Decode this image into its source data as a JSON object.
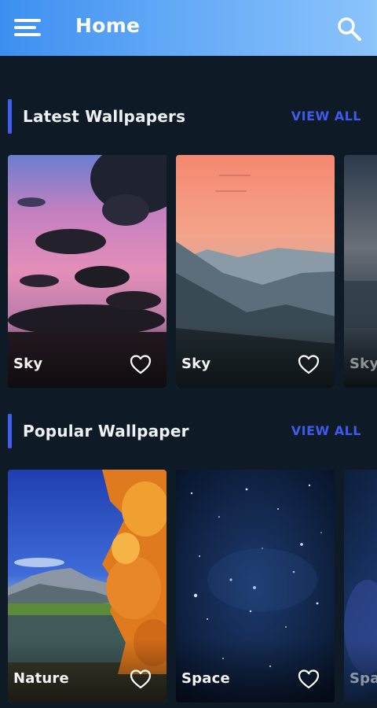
{
  "app_bar": {
    "title": "Home",
    "menu_icon": "hamburger-menu-icon",
    "search_icon": "search-icon",
    "gradient_start": "#3c8ff0",
    "gradient_end": "#8cc4fb"
  },
  "sections": [
    {
      "title": "Latest Wallpapers",
      "action": "VIEW ALL",
      "cards": [
        {
          "label": "Sky",
          "scene": "pink-cloud-sky"
        },
        {
          "label": "Sky",
          "scene": "peach-mountain-sky"
        },
        {
          "label": "Sky",
          "scene": "ocean-dusk"
        }
      ]
    },
    {
      "title": "Popular Wallpaper",
      "action": "VIEW ALL",
      "cards": [
        {
          "label": "Nature",
          "scene": "autumn-lake"
        },
        {
          "label": "Space",
          "scene": "starfield"
        },
        {
          "label": "Space",
          "scene": "nebula"
        }
      ]
    }
  ],
  "favorite_icon": "heart-outline-icon",
  "colors": {
    "background": "#0e1a26",
    "accent": "#3f5df0",
    "view_all": "#3d5bef"
  }
}
